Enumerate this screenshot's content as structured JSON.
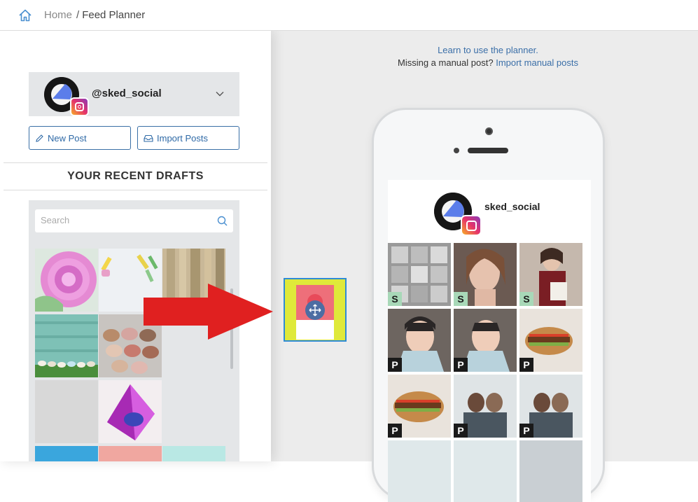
{
  "breadcrumb": {
    "home_label": "Home",
    "separator": "/",
    "current_label": "Feed Planner"
  },
  "account": {
    "handle": "@sked_social"
  },
  "buttons": {
    "new_post": "New Post",
    "import_posts": "Import Posts"
  },
  "drafts": {
    "title": "YOUR RECENT DRAFTS",
    "search_placeholder": "Search"
  },
  "help": {
    "learn_link": "Learn to use the planner.",
    "missing_text": "Missing a manual post?",
    "import_link": "Import manual posts"
  },
  "phone_profile": {
    "username": "sked_social"
  },
  "grid_badges": {
    "row1": [
      "S",
      "S",
      "S"
    ],
    "row2": [
      "P",
      "P",
      "P"
    ],
    "row3": [
      "P",
      "P",
      "P"
    ]
  },
  "colors": {
    "accent": "#2e69a6",
    "badge_s": "#a8d8b8",
    "badge_p": "#1a1a1a",
    "arrow": "#e02020"
  }
}
